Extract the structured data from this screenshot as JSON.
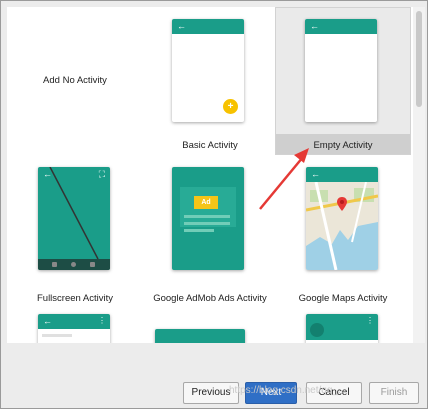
{
  "gallery": {
    "tiles": [
      {
        "label": "Add No Activity"
      },
      {
        "label": "Basic Activity"
      },
      {
        "label": "Empty Activity"
      },
      {
        "label": "Fullscreen Activity"
      },
      {
        "label": "Google AdMob Ads Activity",
        "ad_badge": "Ad"
      },
      {
        "label": "Google Maps Activity"
      }
    ],
    "selected": "Empty Activity"
  },
  "annotation": {
    "color": "#e53935"
  },
  "buttons": {
    "previous": "Previous",
    "next": "Next",
    "cancel": "Cancel",
    "finish": "Finish"
  },
  "watermark": "https://blog.csdn.net/qq_..."
}
